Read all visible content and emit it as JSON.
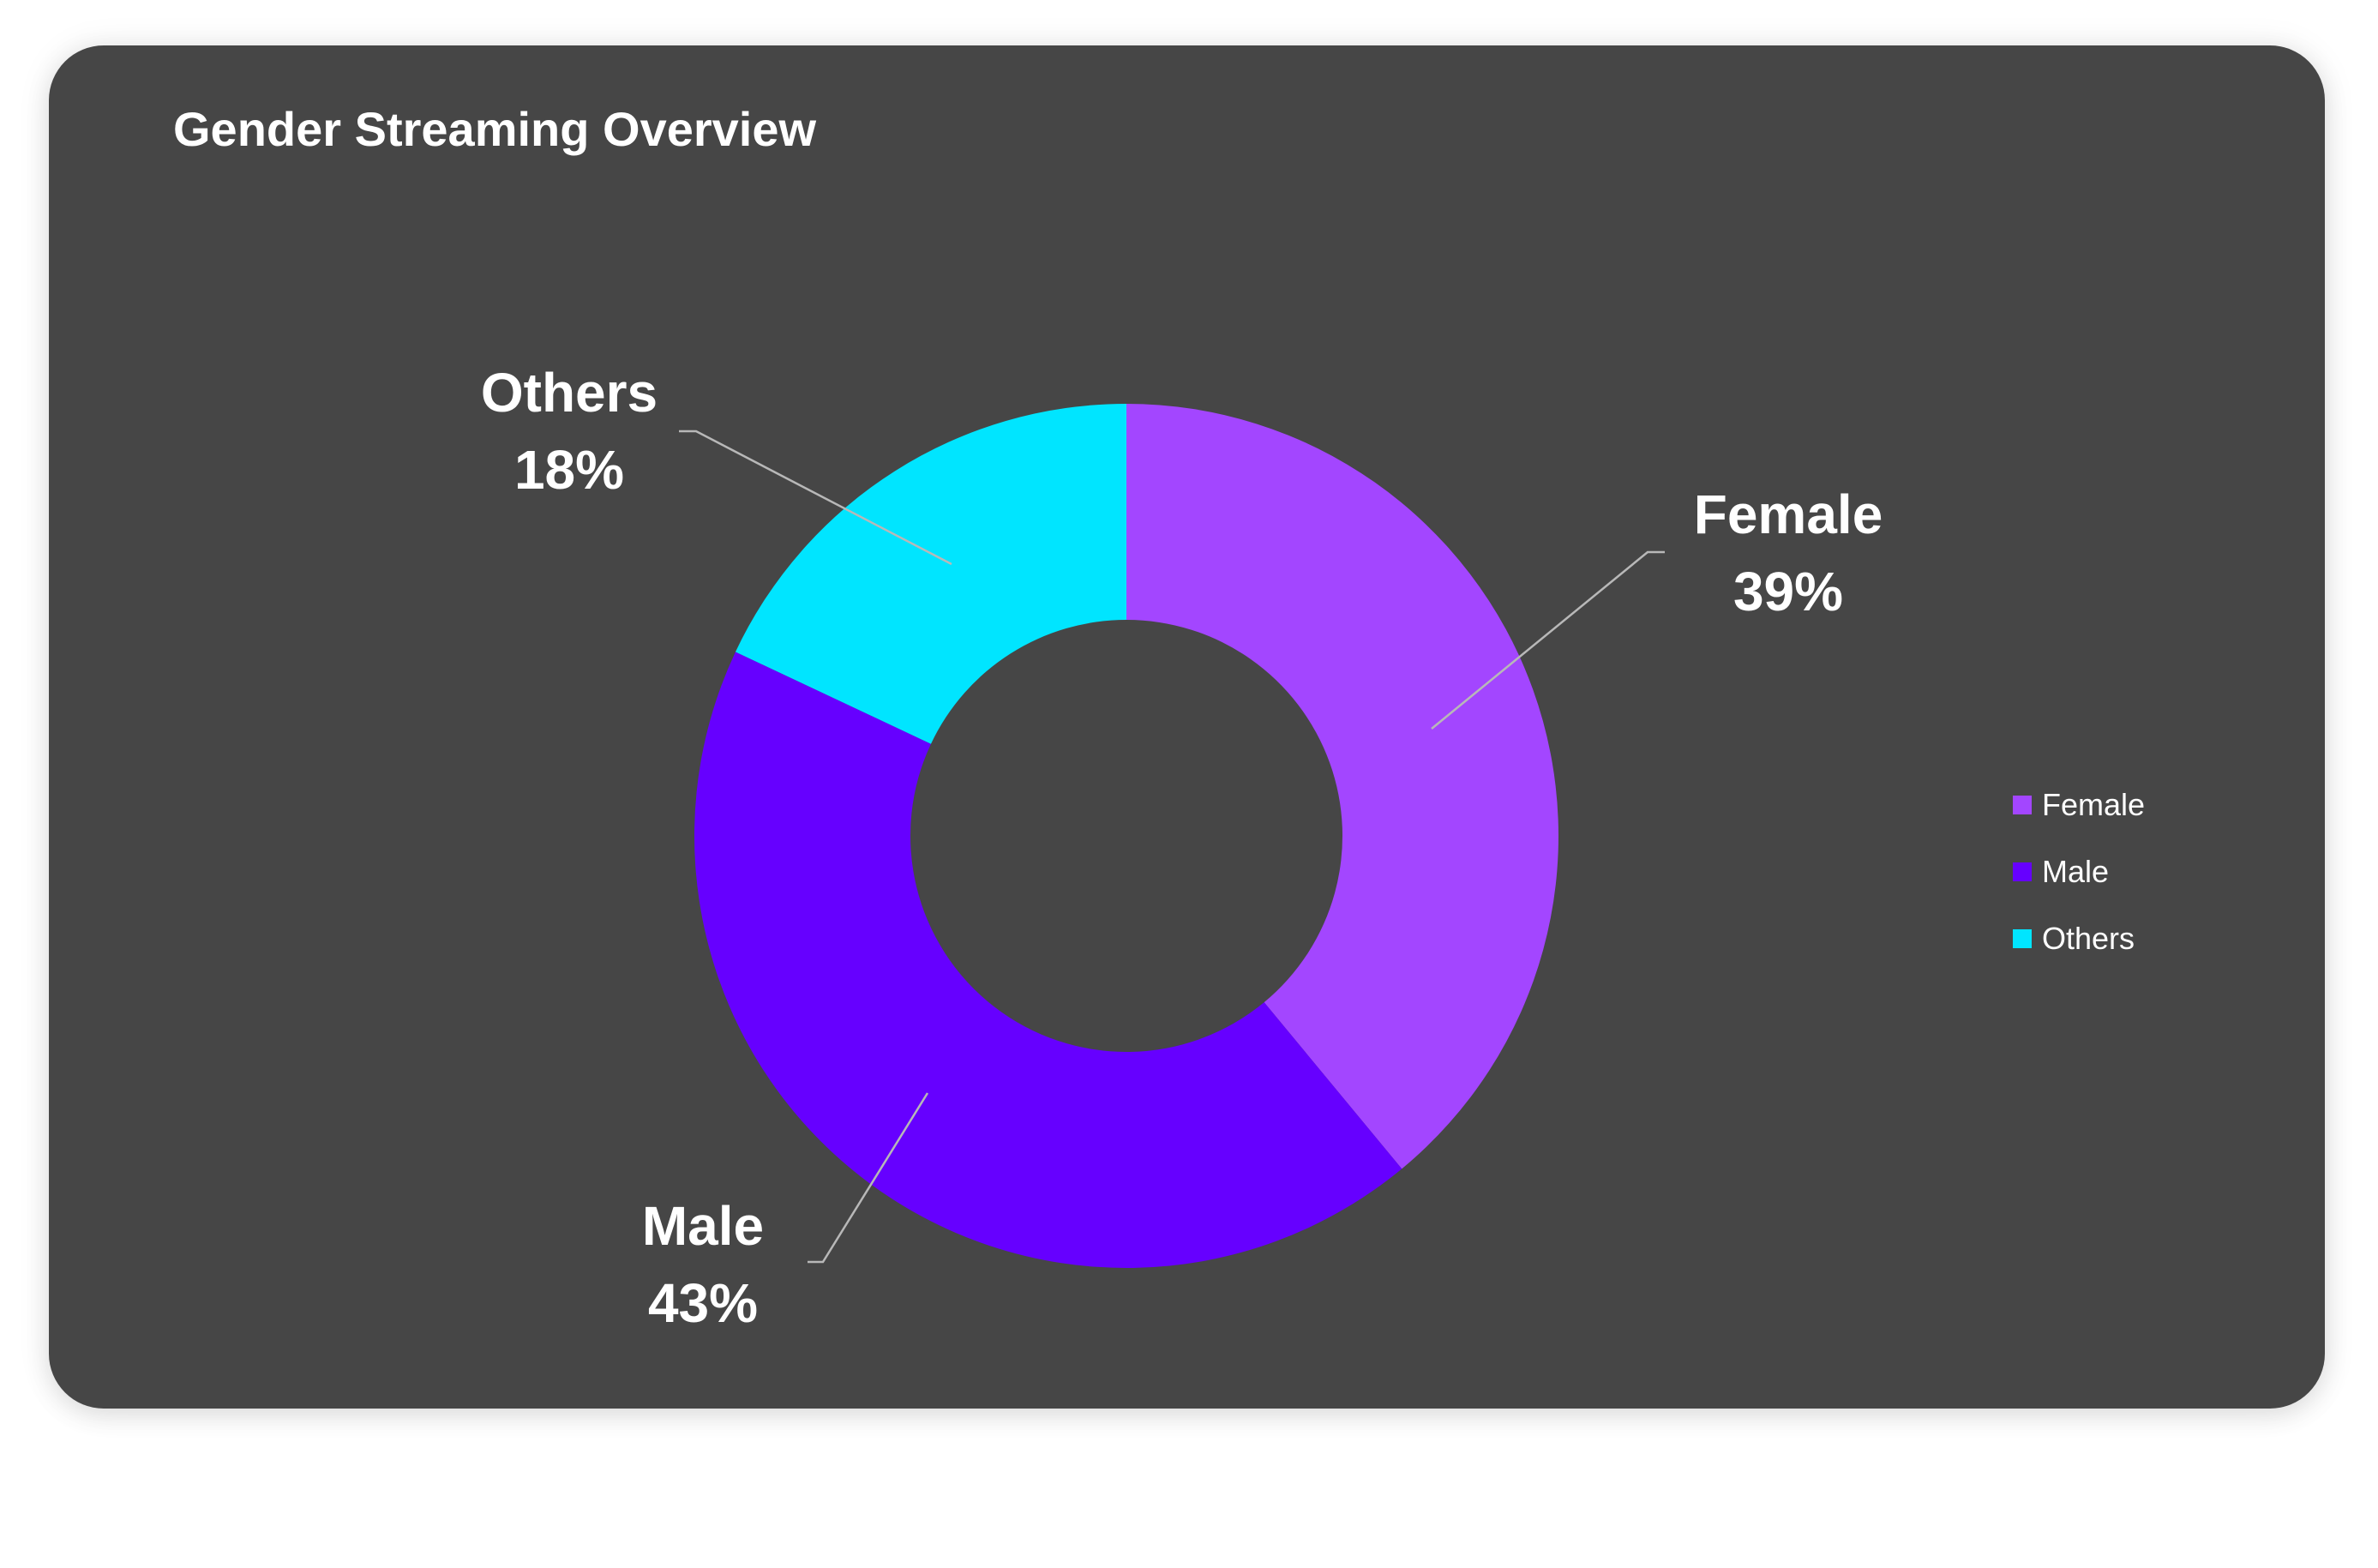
{
  "chart_data": {
    "type": "pie",
    "title": "Gender Streaming Overview",
    "donut": true,
    "categories": [
      "Female",
      "Male",
      "Others"
    ],
    "values": [
      39,
      43,
      18
    ],
    "value_labels": [
      "39%",
      "43%",
      "18%"
    ],
    "colors": [
      "#A346FF",
      "#6600FF",
      "#00E5FF"
    ],
    "legend": {
      "position": "right",
      "entries": [
        "Female",
        "Male",
        "Others"
      ]
    }
  }
}
